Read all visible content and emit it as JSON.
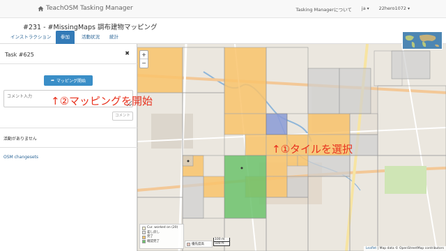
{
  "navbar": {
    "brand": "TeachOSM Tasking Manager",
    "about": "Tasking Managerについて",
    "lang": "ja",
    "user": "22hero1072"
  },
  "project": {
    "title": "#231 - #MissingMaps 調布建物マッピング"
  },
  "tabs": [
    {
      "label": "インストラクション",
      "active": false
    },
    {
      "label": "参加",
      "active": true
    },
    {
      "label": "活動状況",
      "active": false
    },
    {
      "label": "統計",
      "active": false
    }
  ],
  "task": {
    "title": "Task #625",
    "start_button": "マッピング開始",
    "comment_placeholder": "コメント入力",
    "comment_button": "コメント",
    "no_activity": "活動がありません",
    "osm_changesets": "OSM changesets"
  },
  "annotations": {
    "start_mapping": "↑②マッピングを開始",
    "select_tile": "↑①タイルを選択"
  },
  "legend": {
    "items": [
      {
        "label": "Cur. worked on (20)",
        "color": "#fff6d5"
      },
      {
        "label": "差し戻し",
        "color": "#e0e0e0"
      },
      {
        "label": "完了",
        "color": "#f9c36b"
      },
      {
        "label": "確認完了",
        "color": "#6cc26c"
      }
    ],
    "priority_label": "優先度高",
    "priority_color": "#f6c4b8"
  },
  "scale": {
    "top": "100 m",
    "bottom": "500 ft"
  },
  "attribution": {
    "leaflet": "Leaflet",
    "rest": " | Map data © OpenStreetMap contributors"
  },
  "colors": {
    "accent": "#337ab7",
    "annotation": "#e8331f",
    "done": "#f9c36b",
    "validated": "#6cc26c",
    "locked": "#8a9ad6"
  }
}
